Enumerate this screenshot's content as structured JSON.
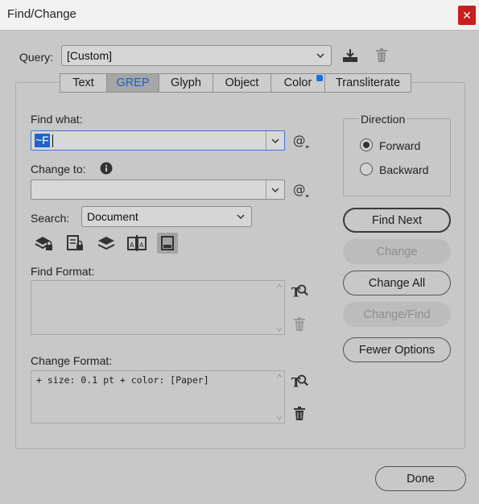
{
  "window": {
    "title": "Find/Change",
    "close_glyph": "✕"
  },
  "query": {
    "label": "Query:",
    "value": "[Custom]",
    "save_icon": "save-query-icon",
    "delete_icon": "delete-query-icon"
  },
  "tabs": [
    {
      "label": "Text",
      "active": false
    },
    {
      "label": "GREP",
      "active": true
    },
    {
      "label": "Glyph",
      "active": false
    },
    {
      "label": "Object",
      "active": false
    },
    {
      "label": "Color",
      "active": false,
      "badge": true
    },
    {
      "label": "Transliterate",
      "active": false
    }
  ],
  "find_what": {
    "label": "Find what:",
    "value": "~F"
  },
  "change_to": {
    "label": "Change to:",
    "value": ""
  },
  "search": {
    "label": "Search:",
    "value": "Document"
  },
  "find_format": {
    "label": "Find Format:",
    "value": ""
  },
  "change_format": {
    "label": "Change Format:",
    "value": "+ size: 0.1 pt + color: [Paper]"
  },
  "direction": {
    "label": "Direction",
    "options": [
      {
        "label": "Forward",
        "checked": true
      },
      {
        "label": "Backward",
        "checked": false
      }
    ]
  },
  "buttons": {
    "find_next": "Find Next",
    "change": "Change",
    "change_all": "Change All",
    "change_find": "Change/Find",
    "fewer_options": "Fewer Options",
    "done": "Done"
  },
  "colors": {
    "accent": "#1473e6",
    "close": "#c81e1e",
    "selection": "#1e64c8"
  }
}
